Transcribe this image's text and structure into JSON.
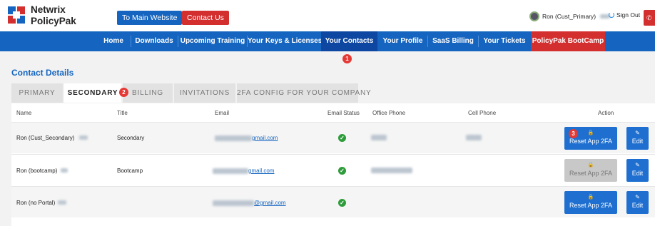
{
  "header": {
    "brand_line1": "Netwrix",
    "brand_line2": "PolicyPak",
    "main_site_button": "To Main Website",
    "contact_us_button": "Contact Us",
    "user_name": "Ron (Cust_Primary)",
    "sign_out": "Sign Out",
    "logo_icon": "netwrix-logo-icon",
    "accent_blue": "#1565c0",
    "accent_red": "#d32f2f"
  },
  "nav": {
    "items": [
      {
        "label": "Home"
      },
      {
        "label": "Downloads"
      },
      {
        "label": "Upcoming Training"
      },
      {
        "label": "Your Keys & Licenses"
      },
      {
        "label": "Your Contacts"
      },
      {
        "label": "Your Profile"
      },
      {
        "label": "SaaS Billing"
      },
      {
        "label": "Your Tickets"
      },
      {
        "label": "PolicyPak BootCamp"
      }
    ],
    "active": "Your Contacts"
  },
  "badges": {
    "nav": "1",
    "tab": "2",
    "row": "3"
  },
  "page": {
    "title": "Contact Details",
    "tabs": [
      {
        "label": "PRIMARY"
      },
      {
        "label": "SECONDARY"
      },
      {
        "label": "BILLING"
      },
      {
        "label": "INVITATIONS"
      },
      {
        "label": "2FA CONFIG FOR YOUR COMPANY"
      }
    ],
    "active_tab": "SECONDARY"
  },
  "table": {
    "headers": {
      "name": "Name",
      "title": "Title",
      "email": "Email",
      "email_status": "Email Status",
      "office_phone": "Office Phone",
      "cell_phone": "Cell Phone",
      "action": "Action"
    },
    "rows": [
      {
        "name": "Ron (Cust_Secondary)",
        "title": "Secondary",
        "email": "gmail.com",
        "reset_label": "Reset App 2FA",
        "reset_enabled": true,
        "edit_label": "Edit"
      },
      {
        "name": "Ron (bootcamp)",
        "title": "Bootcamp",
        "email": "gmail.com",
        "reset_label": "Reset App 2FA",
        "reset_enabled": false,
        "edit_label": "Edit"
      },
      {
        "name": "Ron (no Portal)",
        "title": "",
        "email": "@gmail.com",
        "reset_label": "Reset App 2FA",
        "reset_enabled": true,
        "edit_label": "Edit"
      }
    ]
  }
}
